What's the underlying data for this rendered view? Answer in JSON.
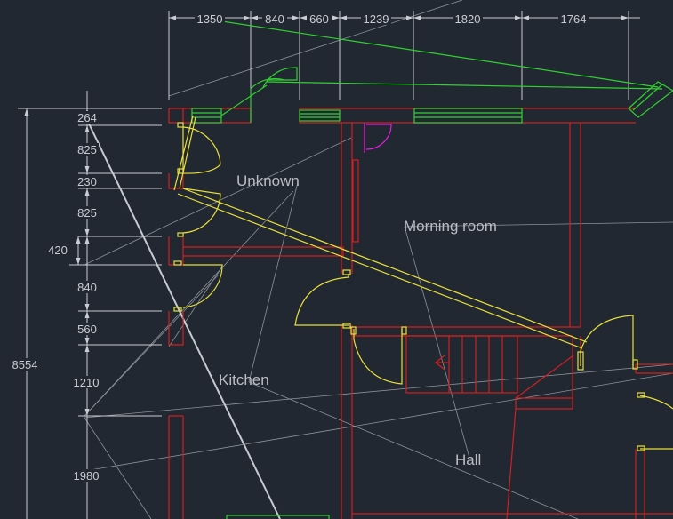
{
  "colors": {
    "background": "#222831",
    "walls": "#d21f1f",
    "doors": "#e8e03a",
    "windows": "#2fd12f",
    "dimensions": "#c8cdd3",
    "magenta": "#e020e0",
    "room_labels": "#b9bec5"
  },
  "top_dimensions": [
    "1350",
    "840",
    "660",
    "1239",
    "1820",
    "1764"
  ],
  "left_dimensions": [
    "264",
    "825",
    "230",
    "825",
    "840",
    "560",
    "1210",
    "1980"
  ],
  "side_dimensions": {
    "offset": "420",
    "overall": "8554"
  },
  "rooms": {
    "unknown": "Unknown",
    "morning_room": "Morning room",
    "kitchen": "Kitchen",
    "hall": "Hall"
  }
}
